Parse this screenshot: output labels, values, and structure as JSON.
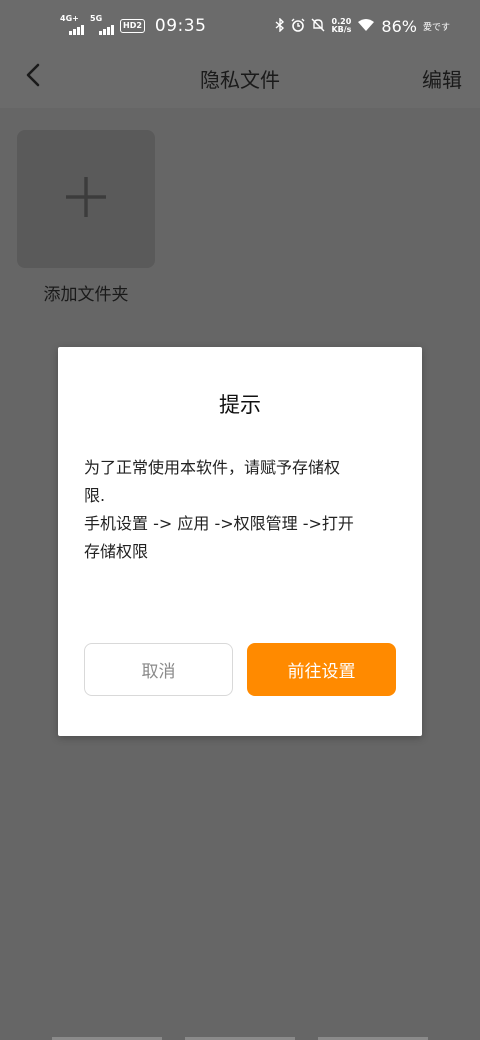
{
  "status_bar": {
    "sim1_tag": "4G+",
    "sim2_tag": "5G",
    "hd_badge": "HD2",
    "time": "09:35",
    "net_speed_value": "0.20",
    "net_speed_unit": "KB/s",
    "battery": "86%",
    "ime": "愛です",
    "icons": [
      "bluetooth-icon",
      "alarm-icon",
      "mute-icon",
      "wifi-icon"
    ]
  },
  "header": {
    "back_icon": "chevron-left-icon",
    "title": "隐私文件",
    "edit_label": "编辑"
  },
  "content": {
    "add_folder_icon": "plus-icon",
    "add_folder_label": "添加文件夹"
  },
  "dialog": {
    "title": "提示",
    "message": "为了正常使用本软件，请赋予存储权\n限.\n手机设置 -> 应用 ->权限管理 ->打开\n存储权限",
    "cancel_label": "取消",
    "confirm_label": "前往设置"
  },
  "colors": {
    "overlay": "#666666",
    "accent": "#ff8a00",
    "dialog_bg": "#ffffff"
  }
}
